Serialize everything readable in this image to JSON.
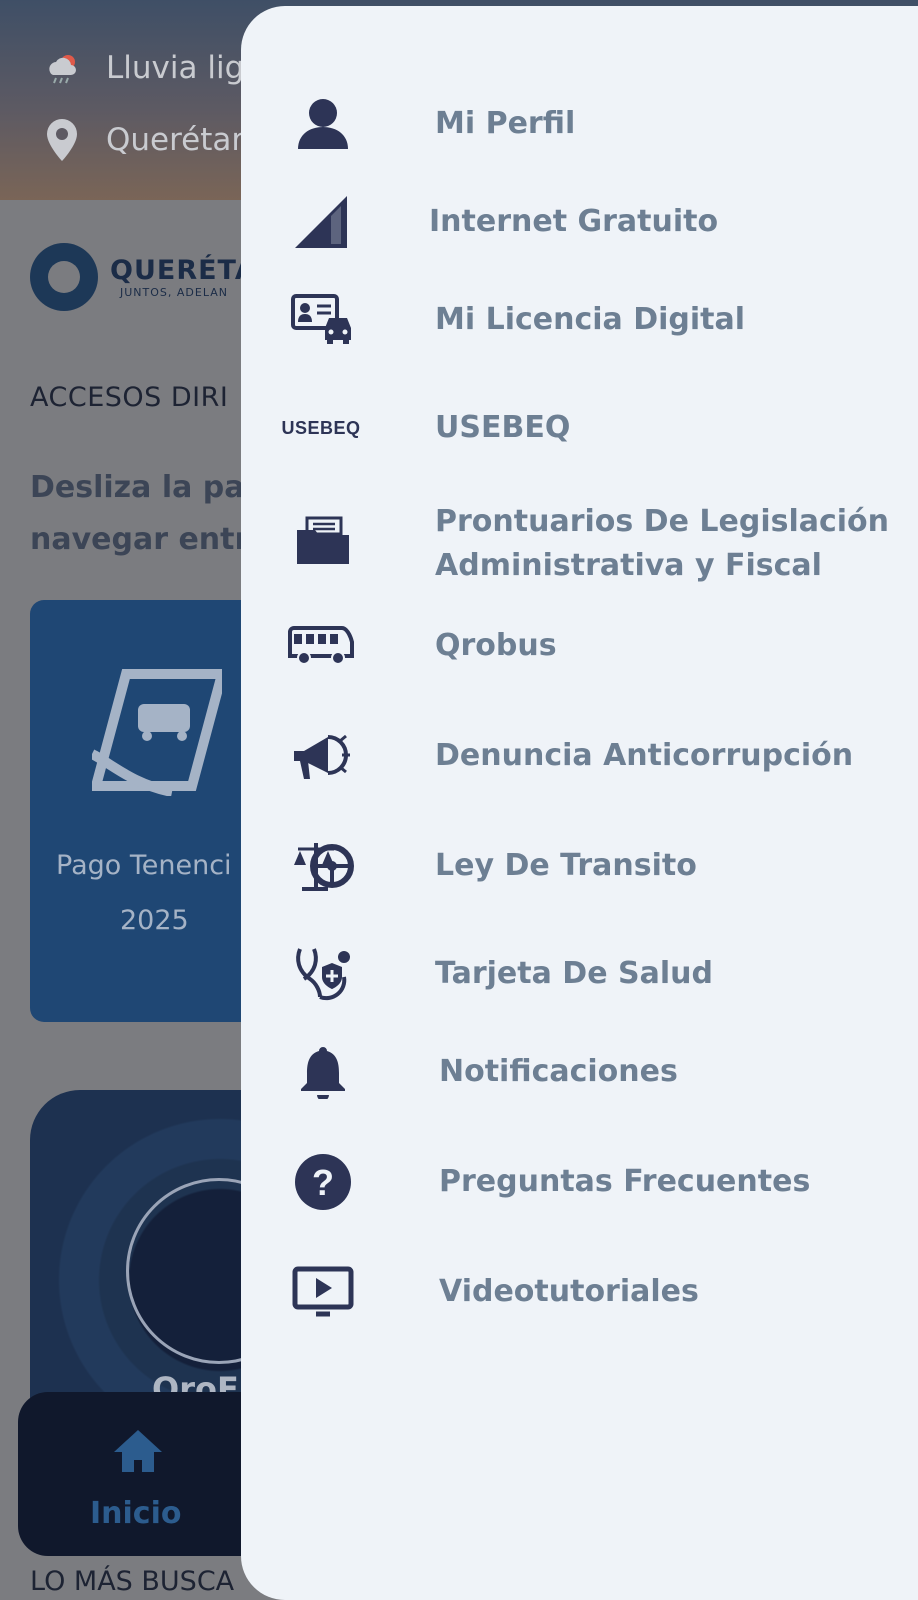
{
  "background": {
    "weather": {
      "condition": "Lluvia lig",
      "location": "Querétar"
    },
    "logo": {
      "title": "QUERÉTA",
      "tagline": "JUNTOS, ADELAN"
    },
    "section_title": "ACCESOS DIRI",
    "hint_line1": "Desliza la par",
    "hint_line2": "navegar entr",
    "card1": {
      "label": "Pago Tenenci",
      "year": "2025"
    },
    "card2": {
      "label": "OroE"
    },
    "tabbar": {
      "home_label": "Inicio"
    },
    "bottom_title": "LO MÁS BUSCA"
  },
  "drawer": {
    "items": [
      {
        "label": "Mi Perfil",
        "icon": "user-icon"
      },
      {
        "label": "Internet Gratuito",
        "icon": "signal-icon"
      },
      {
        "label": "Mi Licencia Digital",
        "icon": "license-car-icon"
      },
      {
        "label": "USEBEQ",
        "icon": "usebeq-icon",
        "icon_text": "USEBEQ"
      },
      {
        "label_line1": "Prontuarios De Legislación",
        "label_line2": "Administrativa y Fiscal",
        "icon": "folder-icon"
      },
      {
        "label": "Qrobus",
        "icon": "bus-icon"
      },
      {
        "label": "Denuncia Anticorrupción",
        "icon": "megaphone-icon"
      },
      {
        "label": "Ley De Transito",
        "icon": "scale-wheel-icon"
      },
      {
        "label": "Tarjeta De Salud",
        "icon": "stethoscope-shield-icon"
      },
      {
        "label": "Notificaciones",
        "icon": "bell-icon"
      },
      {
        "label": "Preguntas Frecuentes",
        "icon": "question-icon"
      },
      {
        "label": "Videotutoriales",
        "icon": "video-icon"
      }
    ]
  },
  "colors": {
    "drawer_bg": "#eff3f8",
    "icon": "#2d3456",
    "label": "#6d7f93",
    "overlay": "#7b7c80"
  }
}
